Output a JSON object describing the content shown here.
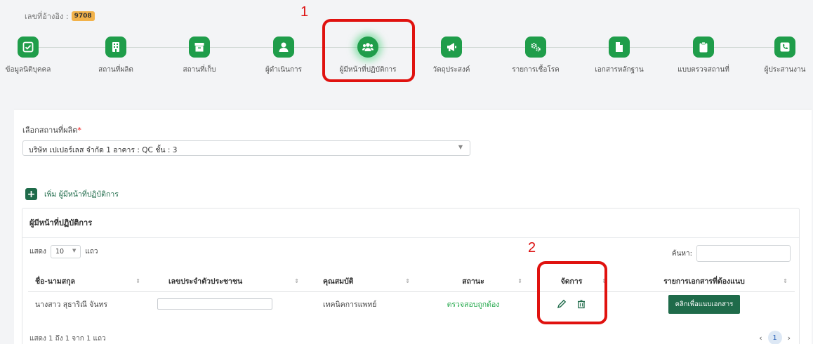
{
  "reference": {
    "label": "เลขที่อ้างอิง :",
    "value": "9708"
  },
  "steps": [
    {
      "label": "ข้อมูลนิติบุคคล",
      "icon": "check-square-icon"
    },
    {
      "label": "สถานที่ผลิต",
      "icon": "building-icon"
    },
    {
      "label": "สถานที่เก็บ",
      "icon": "archive-icon"
    },
    {
      "label": "ผู้ดำเนินการ",
      "icon": "user-icon"
    },
    {
      "label": "ผู้มีหน้าที่ปฏิบัติการ",
      "icon": "users-icon",
      "active": true
    },
    {
      "label": "วัตถุประสงค์",
      "icon": "megaphone-icon"
    },
    {
      "label": "รายการเชื้อโรค",
      "icon": "cogs-icon"
    },
    {
      "label": "เอกสารหลักฐาน",
      "icon": "file-icon"
    },
    {
      "label": "แบบตรวจสถานที่",
      "icon": "clipboard-icon"
    },
    {
      "label": "ผู้ประสานงาน",
      "icon": "phone-icon"
    }
  ],
  "annotations": {
    "one": "1",
    "two": "2"
  },
  "site_select": {
    "label": "เลือกสถานที่ผลิต",
    "required_mark": "*",
    "value": "บริษัท เปเปอร์เลส จำกัด 1 อาคาร : QC ชั้น : 3"
  },
  "add_button": {
    "label": "เพิ่ม ผู้มีหน้าที่ปฏิบัติการ"
  },
  "table_card": {
    "title": "ผู้มีหน้าที่ปฏิบัติการ",
    "length_prefix": "แสดง",
    "length_value": "10",
    "length_suffix": "แถว",
    "search_label": "ค้นหา:",
    "columns": [
      "ชื่อ-นามสกุล",
      "เลขประจำตัวประชาชน",
      "คุณสมบัติ",
      "สถานะ",
      "จัดการ",
      "รายการเอกสารที่ต้องแนบ"
    ],
    "rows": [
      {
        "name": "นางสาว สุธาริณี จันทร",
        "national_id": "",
        "qualification": "เทคนิคการแพทย์",
        "status": "ตรวจสอบถูกต้อง",
        "doc_button": "คลิกเพื่อแนบเอกสาร"
      }
    ],
    "info": "แสดง 1 ถึง 1 จาก 1 แถว",
    "current_page": "1"
  },
  "colors": {
    "brand_green": "#1f9d4a",
    "dark_green": "#1f6b4a",
    "annotation_red": "#e0120f",
    "status_green": "#22a84a"
  }
}
